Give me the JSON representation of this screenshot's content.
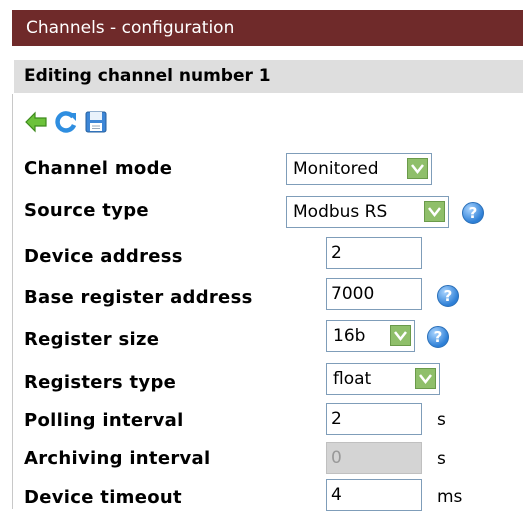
{
  "title": "Channels - configuration",
  "subtitle": "Editing channel number 1",
  "toolbar": {
    "back_icon": "arrow-left-icon",
    "refresh_icon": "refresh-icon",
    "save_icon": "save-icon"
  },
  "help_mark": "?",
  "fields": {
    "channel_mode": {
      "label": "Channel mode",
      "value": "Monitored"
    },
    "source_type": {
      "label": "Source type",
      "value": "Modbus RS"
    },
    "device_address": {
      "label": "Device address",
      "value": "2"
    },
    "base_register_address": {
      "label": "Base register address",
      "value": "7000"
    },
    "register_size": {
      "label": "Register size",
      "value": "16b"
    },
    "registers_type": {
      "label": "Registers type",
      "value": "float"
    },
    "polling_interval": {
      "label": "Polling interval",
      "value": "2",
      "unit": "s"
    },
    "archiving_interval": {
      "label": "Archiving interval",
      "value": "0",
      "unit": "s"
    },
    "device_timeout": {
      "label": "Device timeout",
      "value": "4",
      "unit": "ms"
    }
  },
  "colors": {
    "title_bar": "#6f2a2a",
    "sub_bar": "#dedede",
    "select_arrow": "#8fbf6a",
    "help": "#2d7fd6"
  }
}
